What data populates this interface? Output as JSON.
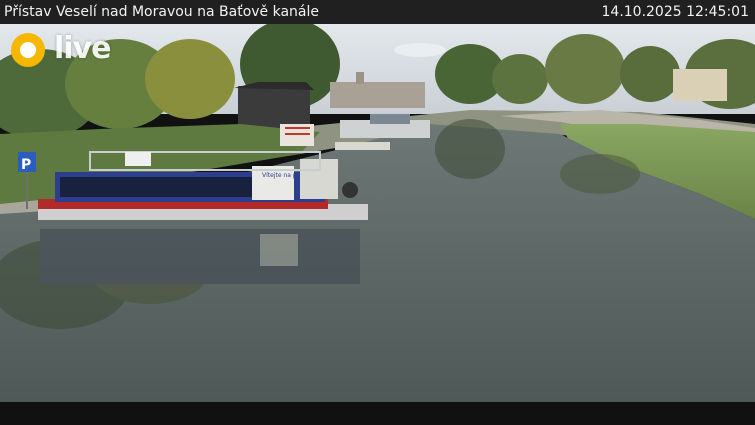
{
  "overlay": {
    "title": "Přístav Veselí nad Moravou na Baťově kanále",
    "timestamp": "14.10.2025 12:45:01"
  },
  "logo": {
    "text": "live",
    "icon": "live-logo-icon",
    "accent_color": "#f5b700"
  },
  "scene": {
    "boat_sign": "Vítejte na palubě",
    "parking_sign": "P",
    "colors": {
      "water": "#5e6a68",
      "sky": "#d8dde2",
      "grass": "#7f9b56",
      "boat_hull": "#2d3e8c",
      "boat_trim": "#b32a2a"
    }
  }
}
